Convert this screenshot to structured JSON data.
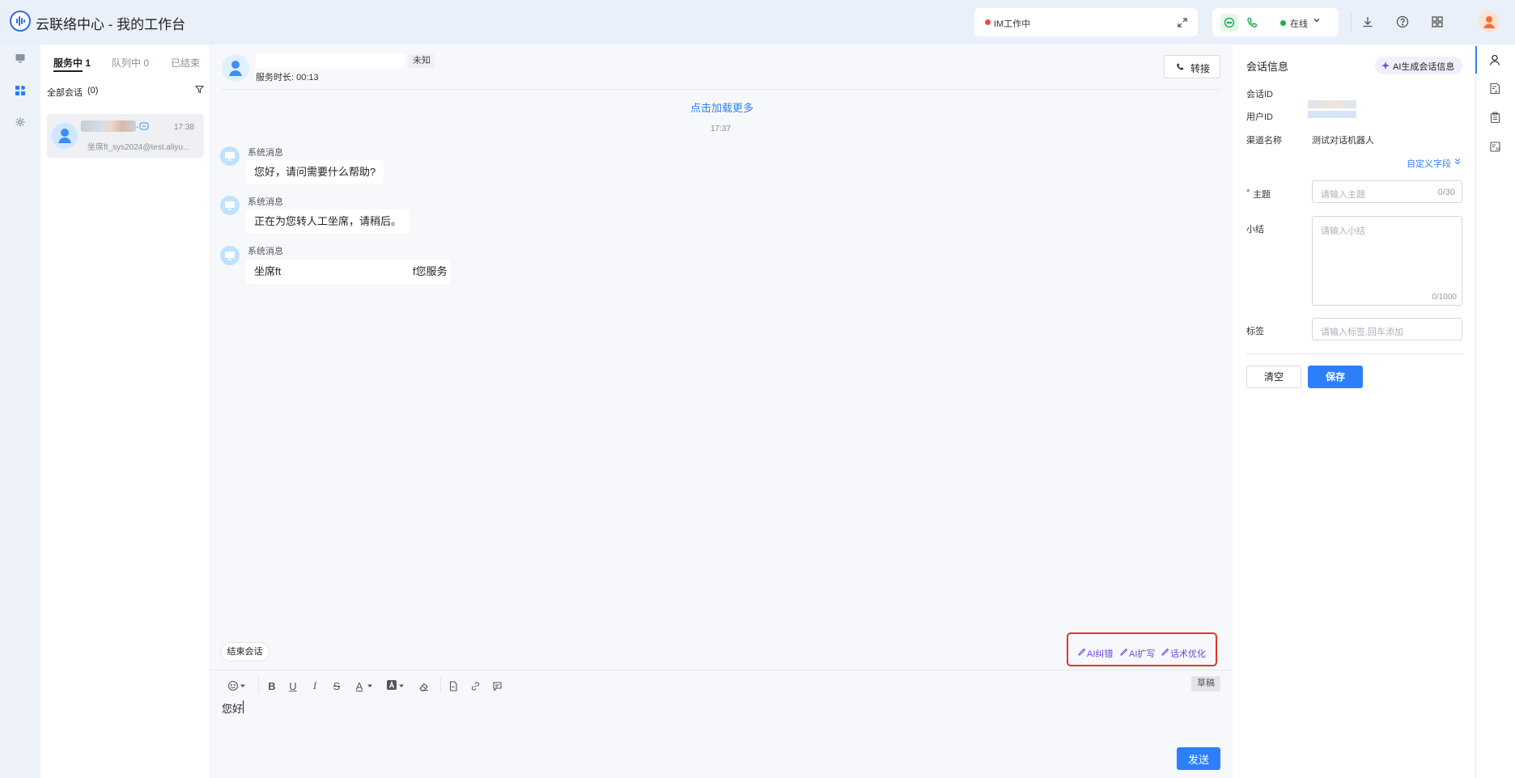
{
  "app": {
    "title": "云联络中心 - 我的工作台"
  },
  "header": {
    "im_status": "IM工作中",
    "online_status": "在线",
    "colors": {
      "im_dot": "#f04a3e",
      "online_dot": "#1fb14f",
      "accent": "#2d7ff9"
    }
  },
  "conversations": {
    "tabs": [
      {
        "label": "服务中 1"
      },
      {
        "label": "队列中 0"
      },
      {
        "label": "已结束"
      }
    ],
    "filter_label": "全部会话",
    "filter_count": "(0)",
    "items": [
      {
        "time": "17:38",
        "preview": "坐席ft_sys2024@test.aliyu..."
      }
    ]
  },
  "chat": {
    "tag": "未知",
    "duration": "服务时长: 00:13",
    "transfer_label": "转接",
    "load_more": "点击加载更多",
    "timestamp": "17:37",
    "messages": [
      {
        "sender": "系统消息",
        "text": "您好，请问需要什么帮助?"
      },
      {
        "sender": "系统消息",
        "text": "正在为您转人工坐席，请稍后。"
      },
      {
        "sender": "系统消息",
        "text_start": "坐席ft",
        "text_end": "f您服务"
      }
    ],
    "end_session": "结束会话",
    "ai_actions": [
      "AI纠错",
      "AI扩写",
      "话术优化"
    ],
    "draft_badge": "草稿",
    "input_value": "您好",
    "send_label": "发送"
  },
  "info": {
    "title": "会话信息",
    "ai_generate": "AI生成会话信息",
    "session_id_label": "会话ID",
    "user_id_label": "用户ID",
    "channel_label": "渠道名称",
    "channel_value": "测试对话机器人",
    "custom_fields": "自定义字段",
    "subject": {
      "required": "*",
      "label": "主题",
      "placeholder": "请输入主题",
      "counter": "0/30"
    },
    "summary": {
      "label": "小结",
      "placeholder": "请输入小结",
      "counter": "0/1000"
    },
    "tags": {
      "label": "标签",
      "placeholder": "请输入标签,回车添加"
    },
    "clear_label": "清空",
    "save_label": "保存"
  }
}
